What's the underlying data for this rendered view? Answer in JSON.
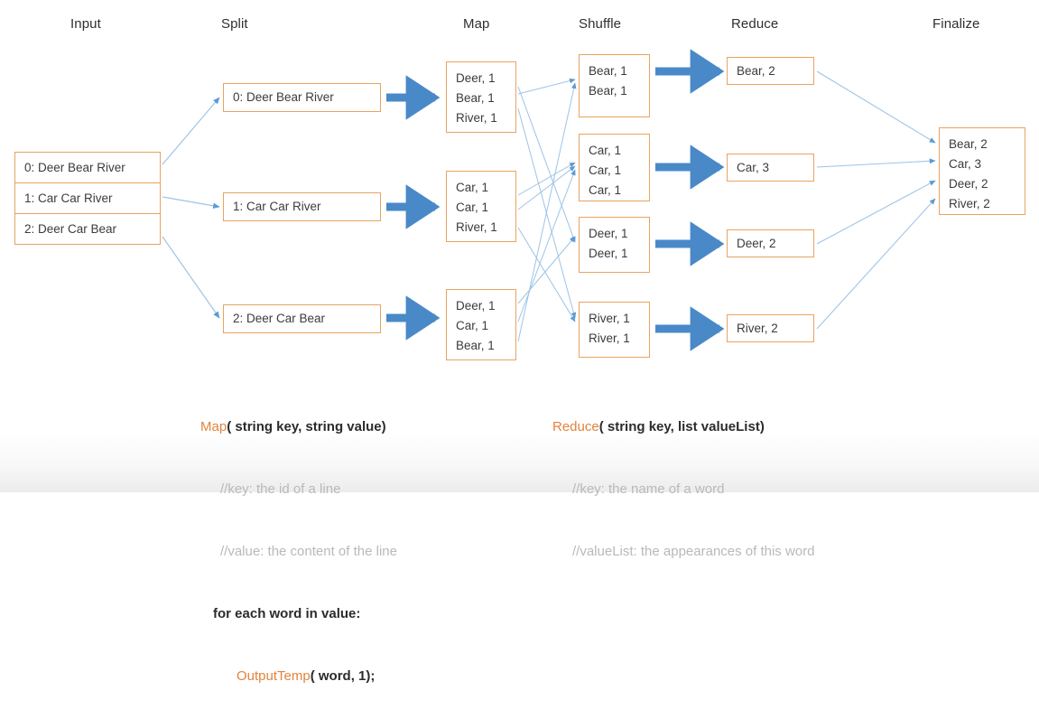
{
  "diagram": {
    "title": "MapReduce word count dataflow",
    "colors": {
      "box_border": "#e8a360",
      "thick_arrow": "#4a89c8",
      "thin_arrow": "#9dc3e6",
      "keyword": "#e2833c",
      "comment": "#b9b9b9",
      "text": "#3b3b3b",
      "background": "#ffffff"
    },
    "headers": [
      {
        "label": "Input"
      },
      {
        "label": "Split"
      },
      {
        "label": "Map"
      },
      {
        "label": "Shuffle"
      },
      {
        "label": "Reduce"
      },
      {
        "label": "Finalize"
      }
    ],
    "input_rows": [
      {
        "text": "0: Deer Bear River"
      },
      {
        "text": "1: Car Car River"
      },
      {
        "text": "2: Deer Car Bear"
      }
    ],
    "split_boxes": [
      {
        "text": "0: Deer Bear River"
      },
      {
        "text": "1: Car Car River"
      },
      {
        "text": "2: Deer Car Bear"
      }
    ],
    "map_boxes": [
      {
        "lines": [
          "Deer, 1",
          "Bear, 1",
          "River, 1"
        ]
      },
      {
        "lines": [
          "Car, 1",
          "Car, 1",
          "River, 1"
        ]
      },
      {
        "lines": [
          "Deer, 1",
          "Car, 1",
          "Bear, 1"
        ]
      }
    ],
    "shuffle_boxes": [
      {
        "lines": [
          "Bear, 1",
          "Bear, 1"
        ]
      },
      {
        "lines": [
          "Car, 1",
          "Car, 1",
          "Car, 1"
        ]
      },
      {
        "lines": [
          "Deer, 1",
          "Deer, 1"
        ]
      },
      {
        "lines": [
          "River, 1",
          "River, 1"
        ]
      }
    ],
    "reduce_boxes": [
      {
        "text": "Bear, 2"
      },
      {
        "text": "Car, 3"
      },
      {
        "text": "Deer, 2"
      },
      {
        "text": "River, 2"
      }
    ],
    "finalize_box": {
      "lines": [
        "Bear, 2",
        "Car, 3",
        "Deer, 2",
        "River, 2"
      ]
    }
  },
  "pseudocode": {
    "map": {
      "signature_keyword": "Map",
      "signature_rest": "( string key, string value)",
      "comment_key": "//key: the id of a line",
      "comment_value": "//value: the content of the line",
      "loop": "for each word in value:",
      "emit_keyword": "OutputTemp",
      "emit_rest": "( word, 1);"
    },
    "reduce": {
      "signature_keyword": "Reduce",
      "signature_rest": "( string key, list valueList)",
      "comment_key": "//key: the name of a word",
      "comment_valuelist": "//valueList: the appearances of this word"
    }
  }
}
